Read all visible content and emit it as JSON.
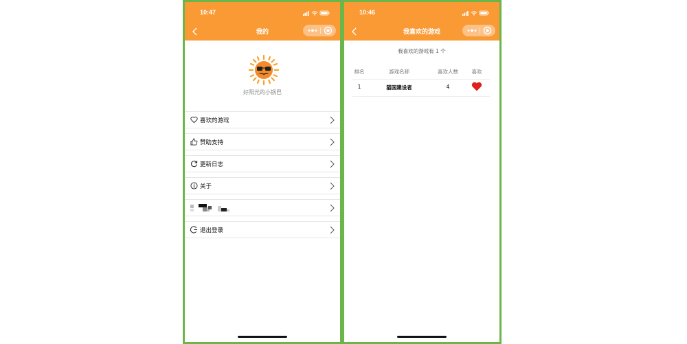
{
  "left_screen": {
    "status_time": "10:47",
    "nav_title": "我的",
    "nickname": "好阳光的小锅巴",
    "menu": [
      {
        "label": "喜欢的游戏",
        "icon": "heart-outline-icon"
      },
      {
        "label": "赞助支持",
        "icon": "thumbs-up-icon"
      },
      {
        "label": "更新日志",
        "icon": "refresh-icon"
      },
      {
        "label": "关于",
        "icon": "info-icon"
      },
      {
        "label": "",
        "icon": "redacted-content"
      },
      {
        "label": "退出登录",
        "icon": "logout-icon"
      }
    ]
  },
  "right_screen": {
    "status_time": "10:46",
    "nav_title": "我喜欢的游戏",
    "summary": "我喜欢的游戏有 1 个",
    "table": {
      "headers": [
        "排名",
        "游戏名称",
        "喜欢人数",
        "喜欢"
      ],
      "rows": [
        {
          "rank": "1",
          "name": "猫国建设者",
          "likes": "4",
          "liked": true
        }
      ]
    }
  },
  "colors": {
    "nav_orange": "#f99a35",
    "frame_green": "#6ab64a",
    "heart_red": "#e0201b"
  }
}
